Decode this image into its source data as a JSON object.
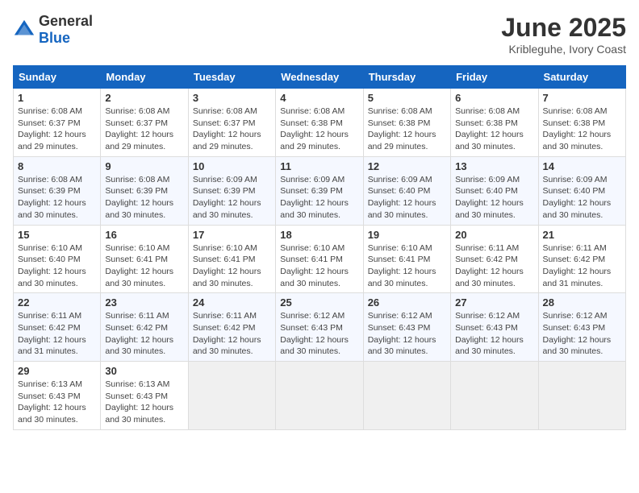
{
  "header": {
    "logo_general": "General",
    "logo_blue": "Blue",
    "title": "June 2025",
    "subtitle": "Kribleguhe, Ivory Coast"
  },
  "calendar": {
    "days_of_week": [
      "Sunday",
      "Monday",
      "Tuesday",
      "Wednesday",
      "Thursday",
      "Friday",
      "Saturday"
    ],
    "weeks": [
      [
        null,
        null,
        null,
        null,
        null,
        null,
        null
      ]
    ],
    "cells": [
      {
        "day": 1,
        "col": 0,
        "sunrise": "6:08 AM",
        "sunset": "6:37 PM",
        "daylight": "12 hours and 29 minutes."
      },
      {
        "day": 2,
        "col": 1,
        "sunrise": "6:08 AM",
        "sunset": "6:37 PM",
        "daylight": "12 hours and 29 minutes."
      },
      {
        "day": 3,
        "col": 2,
        "sunrise": "6:08 AM",
        "sunset": "6:37 PM",
        "daylight": "12 hours and 29 minutes."
      },
      {
        "day": 4,
        "col": 3,
        "sunrise": "6:08 AM",
        "sunset": "6:38 PM",
        "daylight": "12 hours and 29 minutes."
      },
      {
        "day": 5,
        "col": 4,
        "sunrise": "6:08 AM",
        "sunset": "6:38 PM",
        "daylight": "12 hours and 29 minutes."
      },
      {
        "day": 6,
        "col": 5,
        "sunrise": "6:08 AM",
        "sunset": "6:38 PM",
        "daylight": "12 hours and 30 minutes."
      },
      {
        "day": 7,
        "col": 6,
        "sunrise": "6:08 AM",
        "sunset": "6:38 PM",
        "daylight": "12 hours and 30 minutes."
      },
      {
        "day": 8,
        "col": 0,
        "sunrise": "6:08 AM",
        "sunset": "6:39 PM",
        "daylight": "12 hours and 30 minutes."
      },
      {
        "day": 9,
        "col": 1,
        "sunrise": "6:08 AM",
        "sunset": "6:39 PM",
        "daylight": "12 hours and 30 minutes."
      },
      {
        "day": 10,
        "col": 2,
        "sunrise": "6:09 AM",
        "sunset": "6:39 PM",
        "daylight": "12 hours and 30 minutes."
      },
      {
        "day": 11,
        "col": 3,
        "sunrise": "6:09 AM",
        "sunset": "6:39 PM",
        "daylight": "12 hours and 30 minutes."
      },
      {
        "day": 12,
        "col": 4,
        "sunrise": "6:09 AM",
        "sunset": "6:40 PM",
        "daylight": "12 hours and 30 minutes."
      },
      {
        "day": 13,
        "col": 5,
        "sunrise": "6:09 AM",
        "sunset": "6:40 PM",
        "daylight": "12 hours and 30 minutes."
      },
      {
        "day": 14,
        "col": 6,
        "sunrise": "6:09 AM",
        "sunset": "6:40 PM",
        "daylight": "12 hours and 30 minutes."
      },
      {
        "day": 15,
        "col": 0,
        "sunrise": "6:10 AM",
        "sunset": "6:40 PM",
        "daylight": "12 hours and 30 minutes."
      },
      {
        "day": 16,
        "col": 1,
        "sunrise": "6:10 AM",
        "sunset": "6:41 PM",
        "daylight": "12 hours and 30 minutes."
      },
      {
        "day": 17,
        "col": 2,
        "sunrise": "6:10 AM",
        "sunset": "6:41 PM",
        "daylight": "12 hours and 30 minutes."
      },
      {
        "day": 18,
        "col": 3,
        "sunrise": "6:10 AM",
        "sunset": "6:41 PM",
        "daylight": "12 hours and 30 minutes."
      },
      {
        "day": 19,
        "col": 4,
        "sunrise": "6:10 AM",
        "sunset": "6:41 PM",
        "daylight": "12 hours and 30 minutes."
      },
      {
        "day": 20,
        "col": 5,
        "sunrise": "6:11 AM",
        "sunset": "6:42 PM",
        "daylight": "12 hours and 30 minutes."
      },
      {
        "day": 21,
        "col": 6,
        "sunrise": "6:11 AM",
        "sunset": "6:42 PM",
        "daylight": "12 hours and 31 minutes."
      },
      {
        "day": 22,
        "col": 0,
        "sunrise": "6:11 AM",
        "sunset": "6:42 PM",
        "daylight": "12 hours and 31 minutes."
      },
      {
        "day": 23,
        "col": 1,
        "sunrise": "6:11 AM",
        "sunset": "6:42 PM",
        "daylight": "12 hours and 30 minutes."
      },
      {
        "day": 24,
        "col": 2,
        "sunrise": "6:11 AM",
        "sunset": "6:42 PM",
        "daylight": "12 hours and 30 minutes."
      },
      {
        "day": 25,
        "col": 3,
        "sunrise": "6:12 AM",
        "sunset": "6:43 PM",
        "daylight": "12 hours and 30 minutes."
      },
      {
        "day": 26,
        "col": 4,
        "sunrise": "6:12 AM",
        "sunset": "6:43 PM",
        "daylight": "12 hours and 30 minutes."
      },
      {
        "day": 27,
        "col": 5,
        "sunrise": "6:12 AM",
        "sunset": "6:43 PM",
        "daylight": "12 hours and 30 minutes."
      },
      {
        "day": 28,
        "col": 6,
        "sunrise": "6:12 AM",
        "sunset": "6:43 PM",
        "daylight": "12 hours and 30 minutes."
      },
      {
        "day": 29,
        "col": 0,
        "sunrise": "6:13 AM",
        "sunset": "6:43 PM",
        "daylight": "12 hours and 30 minutes."
      },
      {
        "day": 30,
        "col": 1,
        "sunrise": "6:13 AM",
        "sunset": "6:43 PM",
        "daylight": "12 hours and 30 minutes."
      }
    ]
  }
}
